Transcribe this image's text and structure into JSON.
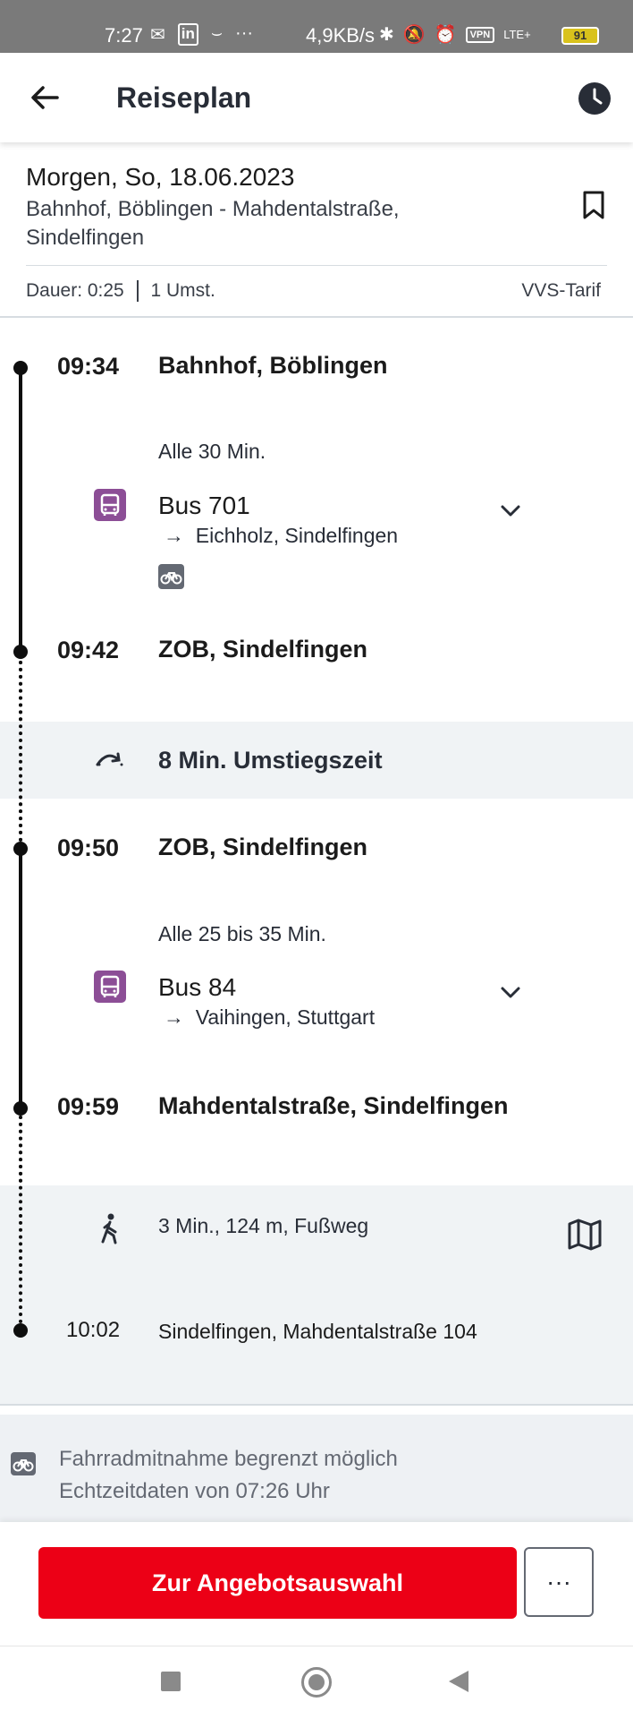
{
  "status_bar": {
    "time": "7:27",
    "network_speed": "4,9KB/s",
    "battery": "91",
    "vpn_label": "VPN",
    "lte_label": "LTE+"
  },
  "app_bar": {
    "title": "Reiseplan"
  },
  "summary": {
    "date": "Morgen, So, 18.06.2023",
    "route": "Bahnhof, Böblingen - Mahdentalstraße, Sindelfingen",
    "duration": "Dauer: 0:25",
    "transfers": "1 Umst.",
    "tariff": "VVS-Tarif"
  },
  "legs": [
    {
      "dep_time": "09:34",
      "dep_stop": "Bahnhof, Böblingen",
      "frequency": "Alle 30 Min.",
      "line": "Bus 701",
      "direction": "Eichholz, Sindelfingen",
      "arr_time": "09:42",
      "arr_stop": "ZOB, Sindelfingen"
    },
    {
      "dep_time": "09:50",
      "dep_stop": "ZOB, Sindelfingen",
      "frequency": "Alle 25 bis 35 Min.",
      "line": "Bus 84",
      "direction": "Vaihingen, Stuttgart",
      "arr_time": "09:59",
      "arr_stop": "Mahdentalstraße, Sindelfingen"
    }
  ],
  "transfer": {
    "label": "8 Min. Umstiegszeit"
  },
  "walk": {
    "text": "3 Min., 124 m, Fußweg",
    "arr_time": "10:02",
    "arr_place": "Sindelfingen, Mahdentalstraße 104"
  },
  "info": {
    "bike_note": "Fahrradmitnahme begrenzt möglich",
    "realtime_note": "Echtzeitdaten von 07:26 Uhr"
  },
  "actions": {
    "primary_label": "Zur Angebotsauswahl",
    "more_label": "···"
  },
  "colors": {
    "primary": "#ec0016",
    "bus": "#8c4e96",
    "timeline": "#0e0e0e",
    "muted_bg": "#f0f3f5"
  }
}
